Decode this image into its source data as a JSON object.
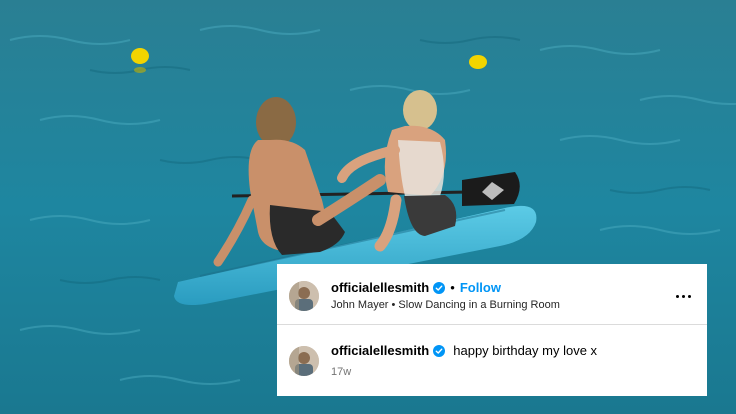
{
  "post": {
    "username": "officialellesmith",
    "separator": "•",
    "follow_label": "Follow",
    "audio": "John Mayer • Slow Dancing in a Burning Room",
    "more_icon": "more-horizontal-icon",
    "verified_icon": "verified-badge-icon",
    "verified_color": "#0095f6"
  },
  "caption": {
    "username": "officialellesmith",
    "text": "happy birthday my love x",
    "age": "17w"
  },
  "colors": {
    "sea": "#1f7f99",
    "paddleboard": "#3fb6d6",
    "buoy": "#f2d400",
    "follow": "#0095f6"
  }
}
